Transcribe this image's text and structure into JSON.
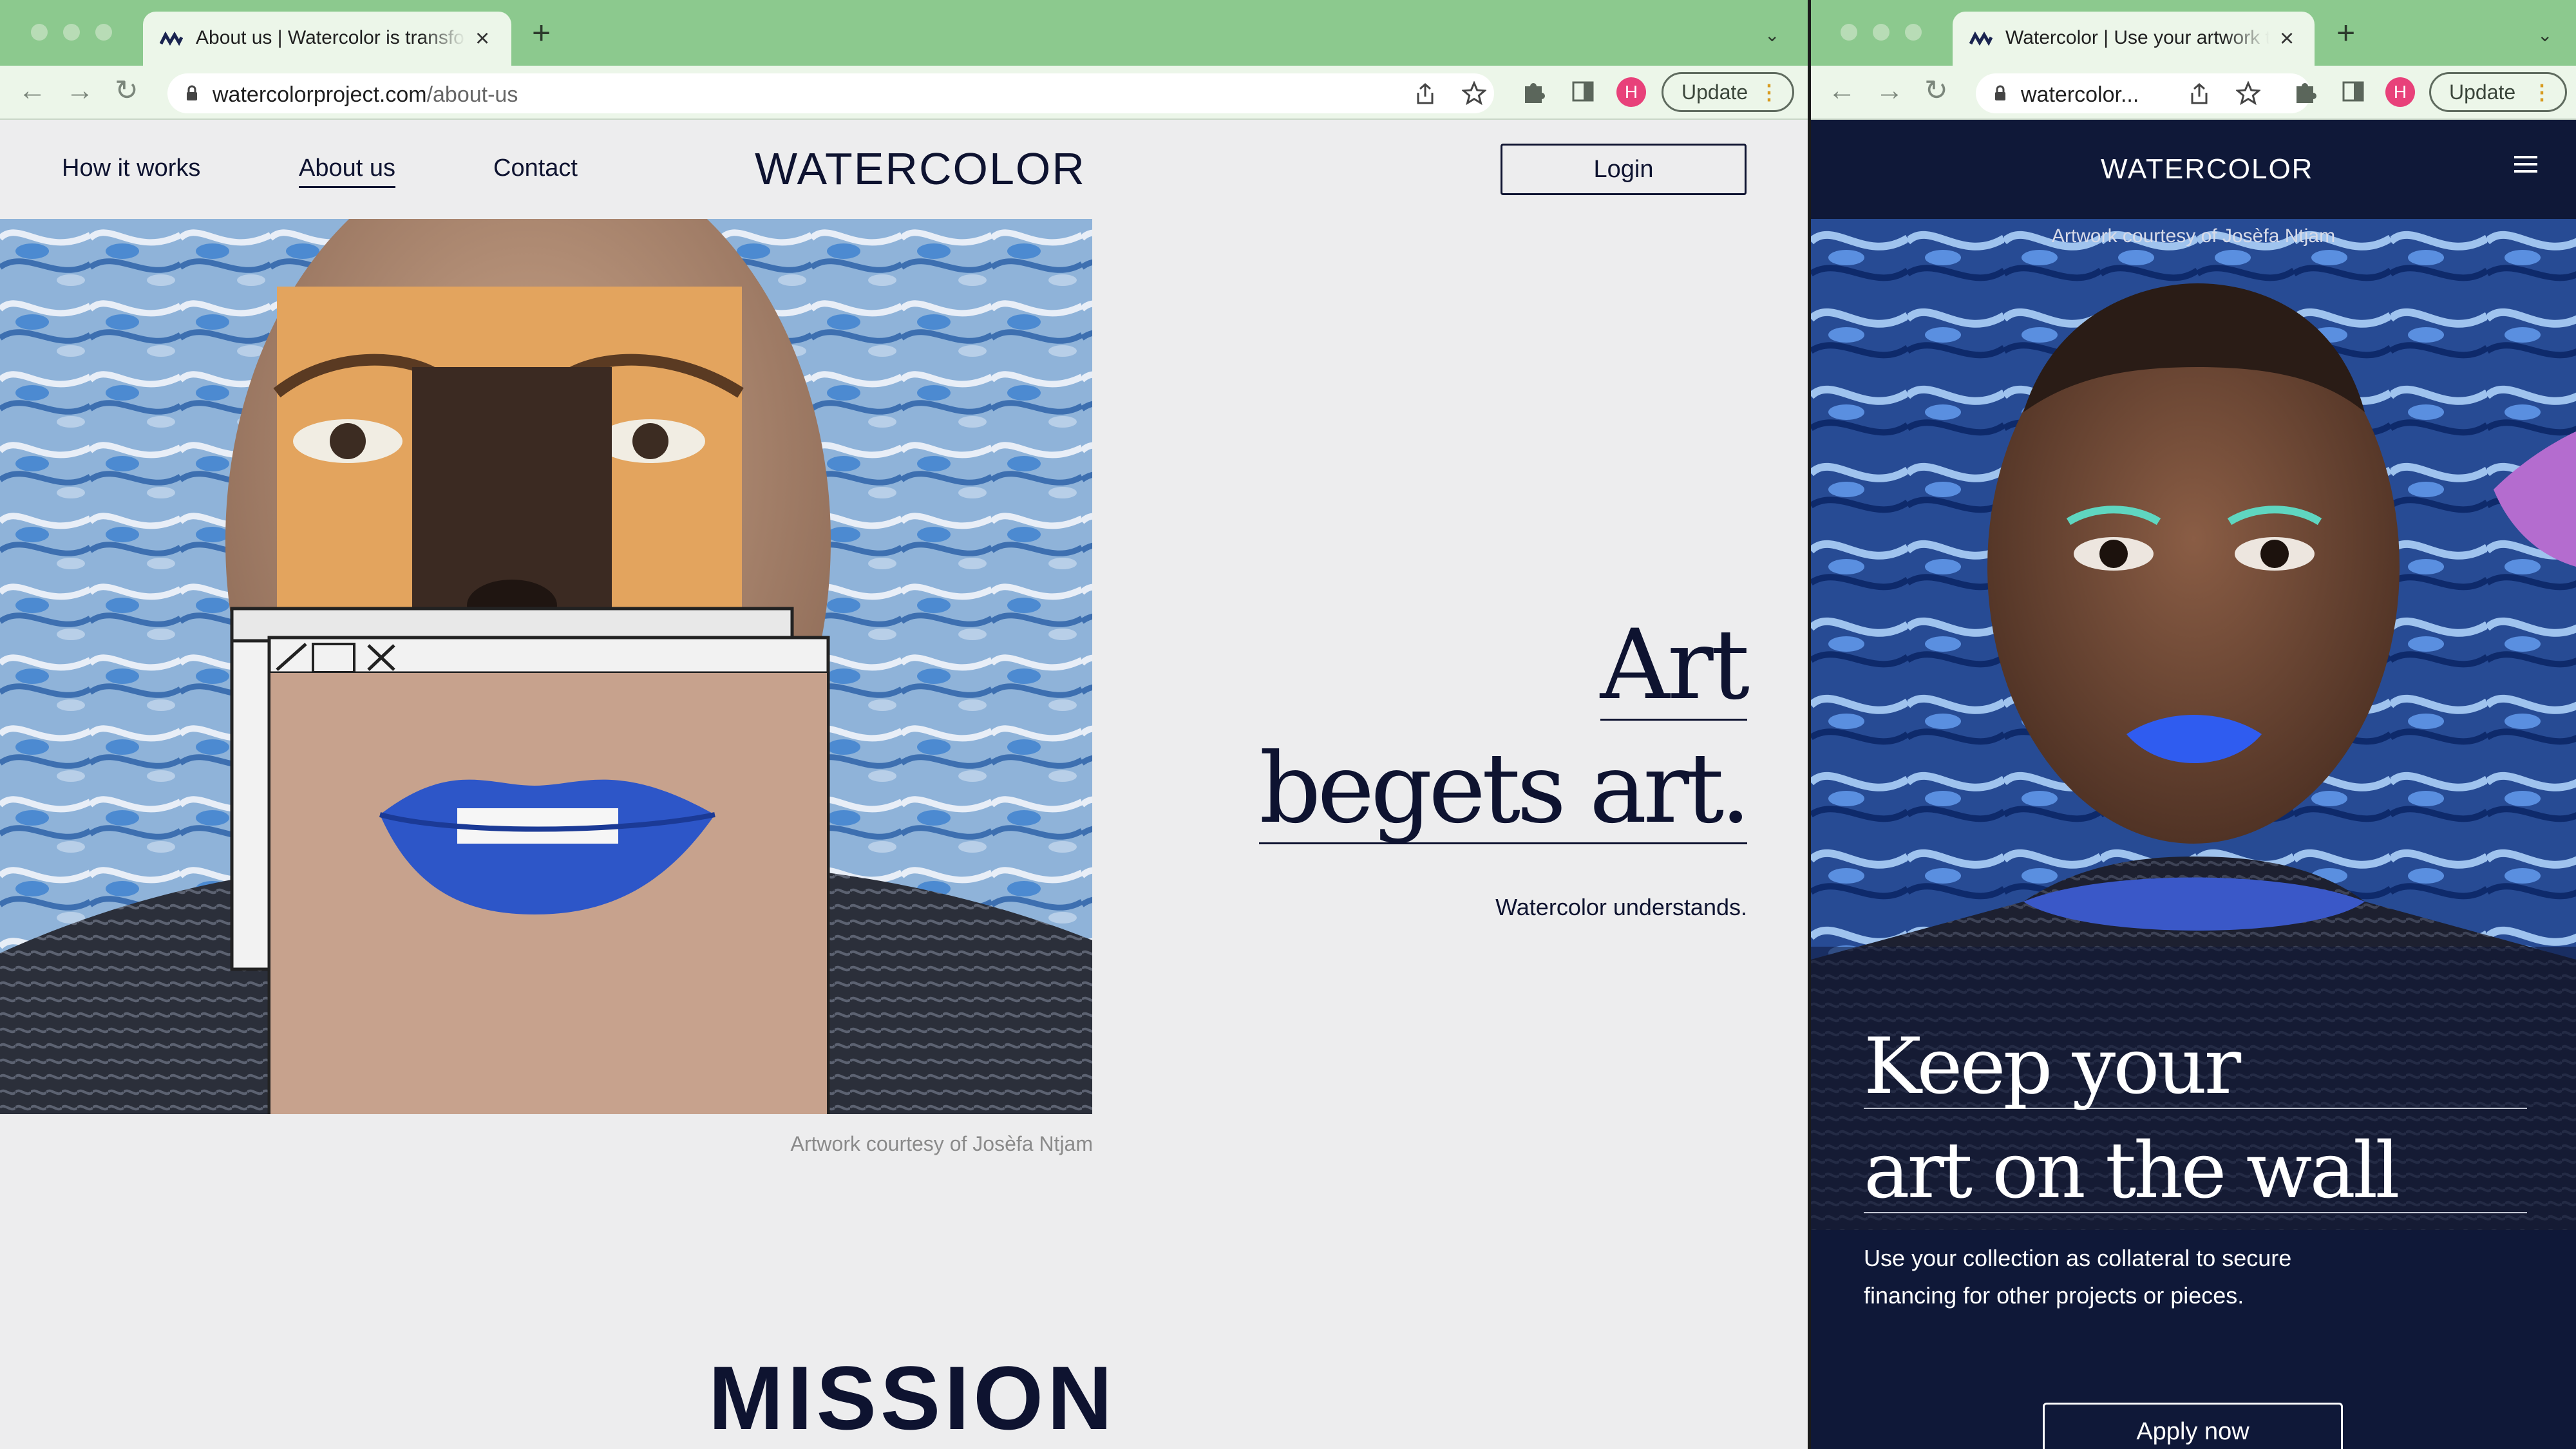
{
  "left_window": {
    "tab": {
      "title": "About us | Watercolor is transfo"
    },
    "url": {
      "domain": "watercolorproject.com",
      "path": "/about-us"
    },
    "update_label": "Update",
    "profile_initial": "H",
    "nav": {
      "how_it_works": "How it works",
      "about_us": "About us",
      "contact": "Contact"
    },
    "logo": "WATERCOLOR",
    "login_label": "Login",
    "hero_caption": "Artwork courtesy of Josèfa Ntjam",
    "headline_line1": "Art",
    "headline_line2": "begets art.",
    "tagline": "Watercolor understands.",
    "section_heading": "MISSION"
  },
  "right_window": {
    "tab": {
      "title": "Watercolor | Use your artwork t"
    },
    "url": {
      "domain": "watercolor..."
    },
    "update_label": "Update",
    "profile_initial": "H",
    "logo": "WATERCOLOR",
    "hero_caption": "Artwork courtesy of Josèfa Ntjam",
    "headline_line1": "Keep your",
    "headline_line2": "art on the wall",
    "body": "Use your collection as collateral to secure financing for other projects or pieces.",
    "cta_label": "Apply now"
  },
  "colors": {
    "tabstrip": "#8cc98e",
    "toolbar": "#ecf6e9",
    "brand_navy": "#0e1330",
    "mobile_bg": "#0f1838",
    "page_bg": "#ededee",
    "avatar": "#e8417a"
  },
  "icons": [
    "close-icon",
    "plus-icon",
    "chevron-down-icon",
    "back-icon",
    "forward-icon",
    "reload-icon",
    "lock-icon",
    "share-icon",
    "star-icon",
    "extensions-icon",
    "side-panel-icon",
    "hamburger-icon",
    "favicon"
  ]
}
